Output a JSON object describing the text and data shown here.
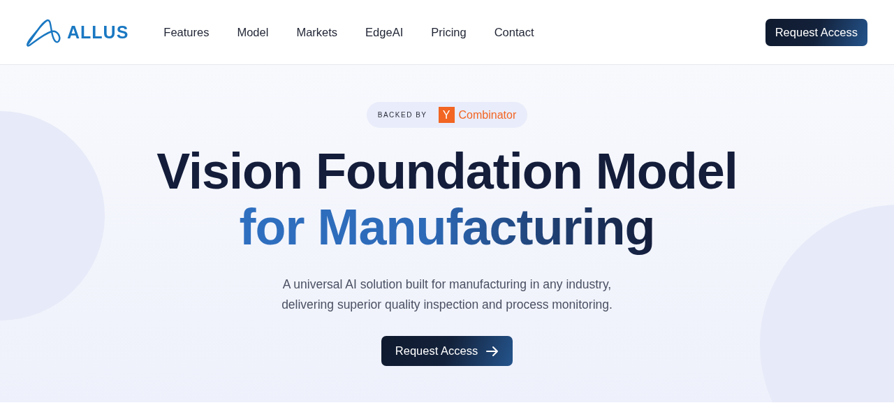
{
  "header": {
    "logo": "ALLUS",
    "nav": [
      "Features",
      "Model",
      "Markets",
      "EdgeAI",
      "Pricing",
      "Contact"
    ],
    "cta": "Request Access"
  },
  "hero": {
    "badge": {
      "label": "BACKED BY",
      "mark": "Y",
      "name": "Combinator"
    },
    "title": "Vision Foundation Model",
    "title_highlight": "for Manufacturing",
    "subtitle": "A universal AI solution built for manufacturing in any industry, delivering superior quality inspection and process monitoring.",
    "cta": "Request Access"
  }
}
